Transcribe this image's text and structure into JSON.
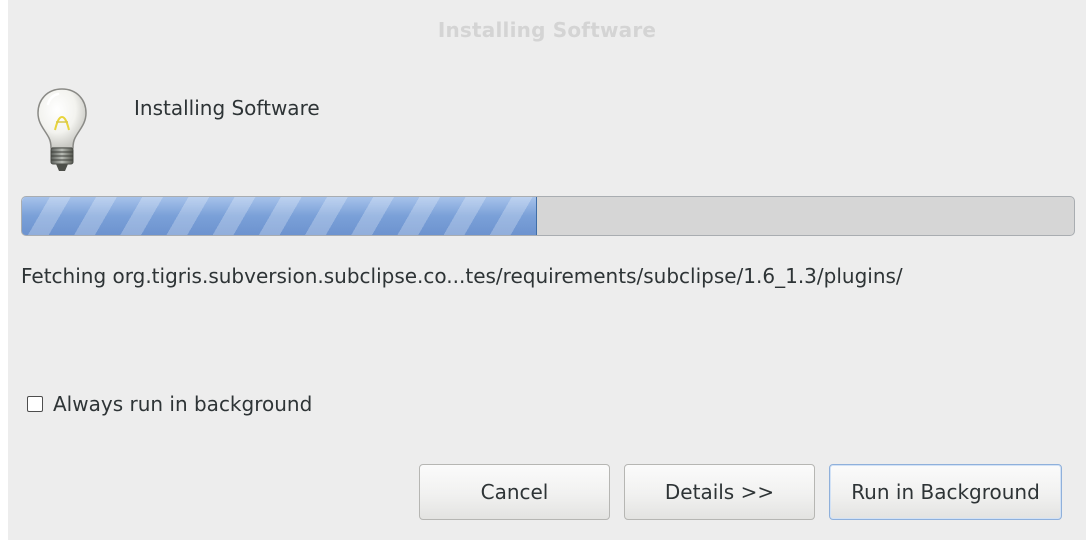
{
  "window": {
    "title": "Installing Software"
  },
  "header": {
    "title": "Installing Software",
    "icon": "lightbulb-icon"
  },
  "progress": {
    "fraction": 0.49
  },
  "status": {
    "text": "Fetching org.tigris.subversion.subclipse.co...tes/requirements/subclipse/1.6_1.3/plugins/"
  },
  "options": {
    "always_run_in_background": {
      "label": "Always run in background",
      "checked": false
    }
  },
  "buttons": {
    "cancel": "Cancel",
    "details": "Details >>",
    "run_in_background": "Run in Background"
  },
  "colors": {
    "progress_fill": "#7ea4d9",
    "progress_track": "#d6d6d6",
    "dialog_background": "#ededed",
    "default_button_border": "#8fb0db"
  }
}
